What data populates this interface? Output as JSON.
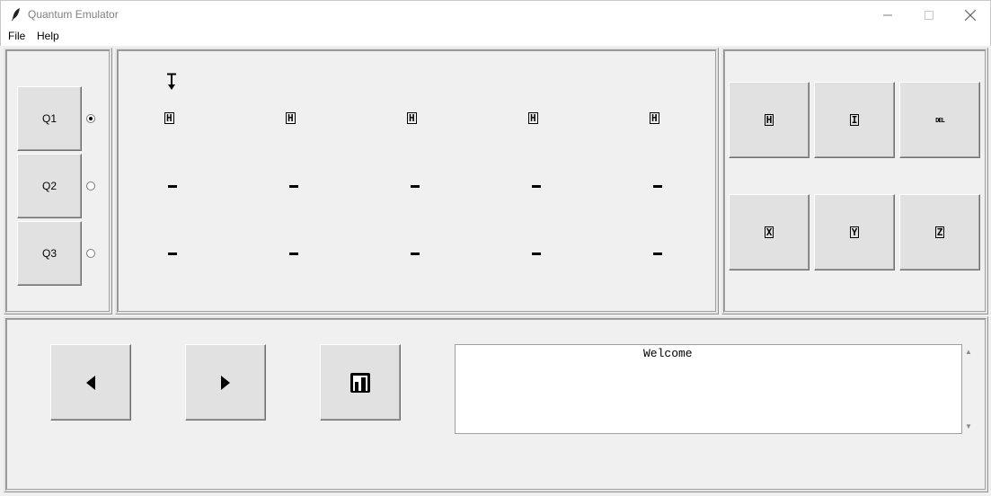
{
  "window": {
    "title": "Quantum Emulator",
    "icon": "feather-icon"
  },
  "menu": {
    "items": [
      "File",
      "Help"
    ]
  },
  "qubits": {
    "items": [
      {
        "label": "Q1",
        "selected": true
      },
      {
        "label": "Q2",
        "selected": false
      },
      {
        "label": "Q3",
        "selected": false
      }
    ]
  },
  "circuit": {
    "cursor_icon": "text-cursor-icon",
    "rows": [
      [
        "H",
        "H",
        "H",
        "H",
        "H"
      ],
      [
        "-",
        "-",
        "-",
        "-",
        "-"
      ],
      [
        "-",
        "-",
        "-",
        "-",
        "-"
      ]
    ]
  },
  "gates": {
    "items": [
      {
        "label": "H",
        "name": "h-gate"
      },
      {
        "label": "I",
        "name": "i-gate"
      },
      {
        "label": "DEL",
        "name": "delete"
      },
      {
        "label": "X",
        "name": "x-gate"
      },
      {
        "label": "Y",
        "name": "y-gate"
      },
      {
        "label": "Z",
        "name": "z-gate"
      }
    ]
  },
  "controls": {
    "prev_icon": "left-triangle-icon",
    "next_icon": "right-triangle-icon",
    "save_icon": "floppy-disk-icon"
  },
  "output": {
    "text": "Welcome"
  }
}
